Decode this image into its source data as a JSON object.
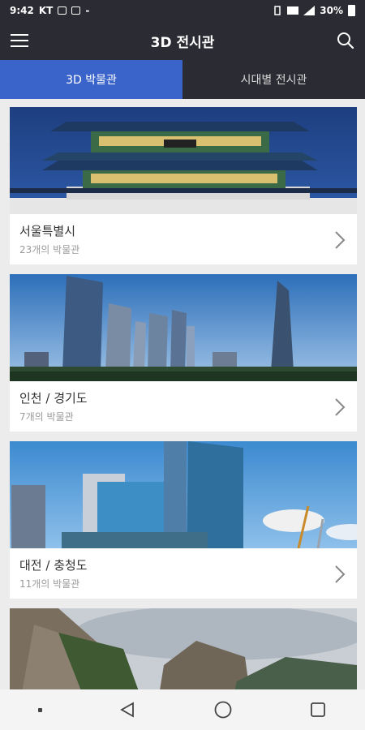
{
  "status": {
    "time": "9:42",
    "carrier": "KT",
    "battery": "30%"
  },
  "header": {
    "title": "3D 전시관"
  },
  "tabs": [
    {
      "label": "3D 박물관",
      "active": true
    },
    {
      "label": "시대별 전시관",
      "active": false
    }
  ],
  "cards": [
    {
      "title": "서울특별시",
      "subtitle": "23개의 박물관"
    },
    {
      "title": "인천 / 경기도",
      "subtitle": "7개의 박물관"
    },
    {
      "title": "대전 / 충청도",
      "subtitle": "11개의 박물관"
    }
  ],
  "colors": {
    "bar": "#2b2b33",
    "accent": "#3a64c9",
    "background": "#ececec"
  },
  "icons": {
    "menu": "hamburger-menu-icon",
    "search": "search-icon",
    "chevron": "chevron-right-icon"
  }
}
